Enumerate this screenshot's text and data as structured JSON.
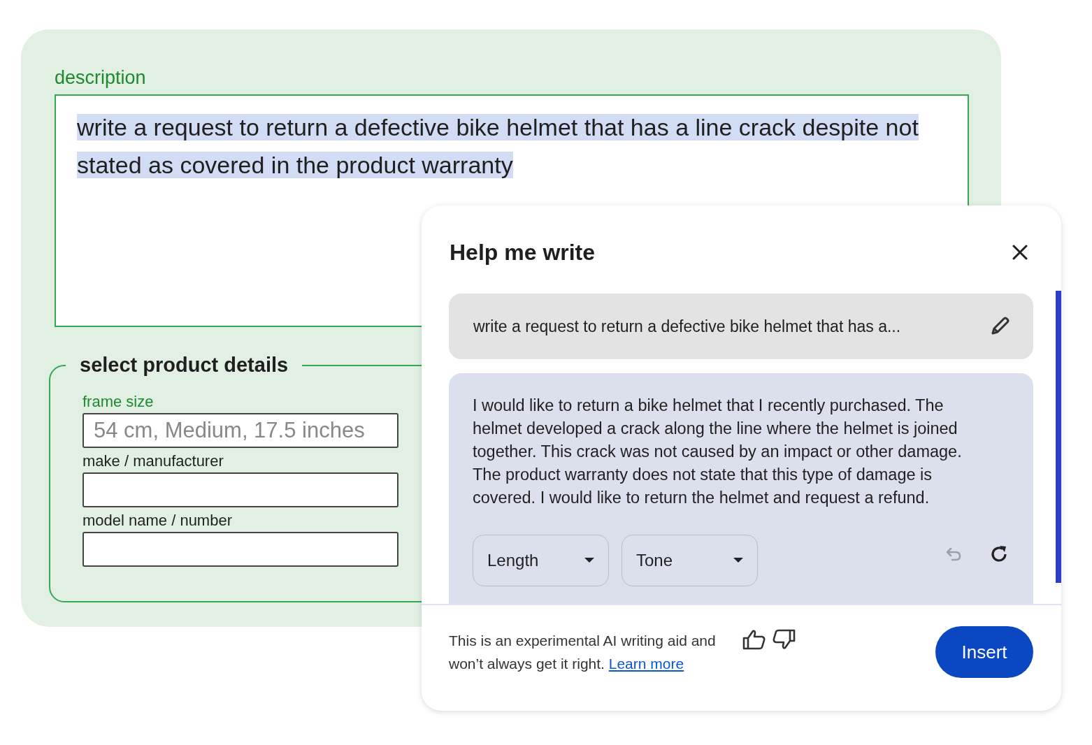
{
  "form": {
    "description": {
      "label": "description",
      "focused": true,
      "value": "write a request to return a defective bike helmet that has a line crack despite not stated as covered in the product warranty",
      "highlighted": true
    },
    "details": {
      "legend": "select product details",
      "fields": [
        {
          "label": "frame size",
          "focused": true,
          "placeholder": "54 cm, Medium, 17.5 inches"
        },
        {
          "label": "make / manufacturer",
          "focused": false
        },
        {
          "label": "model name / number",
          "focused": false
        }
      ]
    }
  },
  "dialog": {
    "title": "Help me write",
    "prompt": "write a request to return a defective bike helmet that has a...",
    "response": "I would like to return a bike helmet that I recently purchased. The helmet developed a crack along the line where the helmet is joined together. This crack was not caused by an impact or other damage. The product warranty does not state that this type of damage is covered. I would like to return the helmet and request a refund.",
    "undo_disabled": true,
    "dropdowns": [
      {
        "label": "Length"
      },
      {
        "label": "Tone"
      }
    ],
    "disclaimer": "This is an experimental AI writing aid and won’t always get it right.",
    "link": "Learn more",
    "insert": "Insert"
  }
}
